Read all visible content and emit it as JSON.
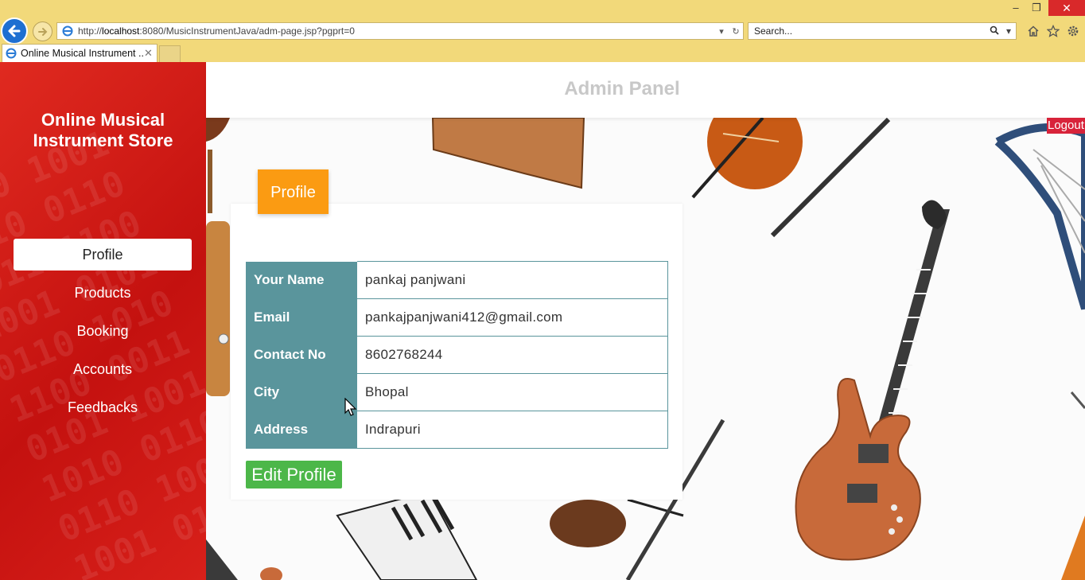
{
  "browser": {
    "url_prefix": "http://",
    "url_host": "localhost",
    "url_rest": ":8080/MusicInstrumentJava/adm-page.jsp?pgprt=0",
    "search_placeholder": "Search...",
    "tab_title": "Online Musical Instrument ...",
    "icons": [
      "back-arrow",
      "forward-arrow",
      "ie-logo",
      "dropdown",
      "refresh",
      "search",
      "home",
      "star",
      "gear",
      "minimize",
      "restore",
      "close"
    ]
  },
  "sidebar": {
    "brand": "Online Musical Instrument Store",
    "items": [
      {
        "label": "Profile",
        "active": true
      },
      {
        "label": "Products"
      },
      {
        "label": "Booking"
      },
      {
        "label": "Accounts"
      },
      {
        "label": "Feedbacks"
      }
    ]
  },
  "header": {
    "title": "Admin Panel",
    "logout": "Logout"
  },
  "profile": {
    "badge": "Profile",
    "rows": [
      {
        "label": "Your Name",
        "value": "pankaj panjwani"
      },
      {
        "label": "Email",
        "value": "pankajpanjwani412@gmail.com"
      },
      {
        "label": "Contact No",
        "value": "8602768244"
      },
      {
        "label": "City",
        "value": "Bhopal"
      },
      {
        "label": "Address",
        "value": "Indrapuri"
      }
    ],
    "edit_button": "Edit Profile"
  },
  "colors": {
    "sidebar_red": "#d4191a",
    "label_teal": "#5a959c",
    "badge_orange": "#fb9b12",
    "edit_green": "#4cb749",
    "logout_red": "#d8233a",
    "chrome_yellow": "#f2d97a"
  }
}
